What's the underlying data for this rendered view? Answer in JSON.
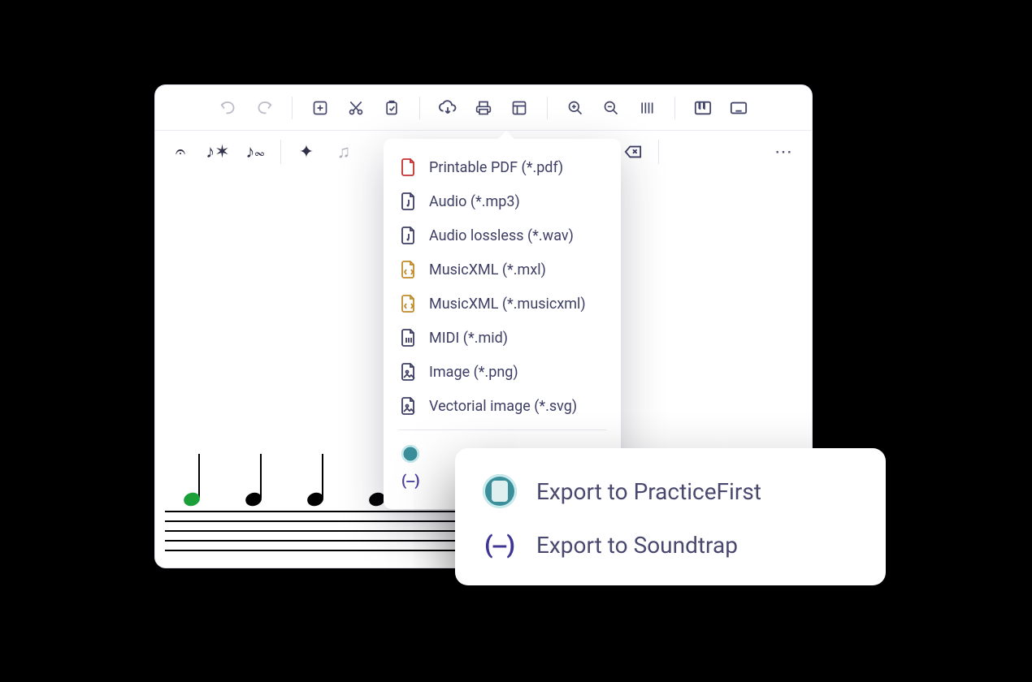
{
  "toolbar": {
    "undo": "undo",
    "redo": "redo",
    "add": "add-box",
    "cut": "cut",
    "paste": "clipboard-check",
    "download": "cloud-download",
    "print": "print",
    "layout": "layout",
    "zoom_in": "zoom-in",
    "zoom_out": "zoom-out",
    "bars": "bar-lines",
    "piano": "piano",
    "keyboard": "keyboard"
  },
  "notationToolbar": {
    "items": [
      {
        "name": "caesura",
        "glyph": "𝄐"
      },
      {
        "name": "tremolo",
        "glyph": "♪✶"
      },
      {
        "name": "tremolo-two",
        "glyph": "♪𝆗"
      },
      {
        "name": "accent",
        "glyph": "✦"
      },
      {
        "name": "beam",
        "glyph": "♫",
        "disabled": true
      }
    ],
    "delete": "delete",
    "more": "⋯"
  },
  "exportMenu": {
    "items": [
      {
        "label": "Printable PDF (*.pdf)",
        "icon": "pdf",
        "color": "#c53030"
      },
      {
        "label": "Audio (*.mp3)",
        "icon": "audio",
        "color": "#3c3e64"
      },
      {
        "label": "Audio lossless (*.wav)",
        "icon": "audio",
        "color": "#3c3e64"
      },
      {
        "label": "MusicXML (*.mxl)",
        "icon": "xml",
        "color": "#c08b2b"
      },
      {
        "label": "MusicXML (*.musicxml)",
        "icon": "xml",
        "color": "#c08b2b"
      },
      {
        "label": "MIDI (*.mid)",
        "icon": "midi",
        "color": "#3c3e64"
      },
      {
        "label": "Image (*.png)",
        "icon": "image",
        "color": "#3c3e64"
      },
      {
        "label": "Vectorial image (*.svg)",
        "icon": "image",
        "color": "#3c3e64"
      }
    ],
    "extra": [
      {
        "label": "Export to PracticeFirst",
        "type": "circle"
      },
      {
        "label": "Export to Soundtrap",
        "type": "bracket",
        "glyph": "(‒)"
      }
    ]
  },
  "magnified": {
    "items": [
      {
        "label": "Export to PracticeFirst",
        "type": "circle"
      },
      {
        "label": "Export to Soundtrap",
        "type": "bracket",
        "glyph": "(‒)"
      }
    ]
  }
}
